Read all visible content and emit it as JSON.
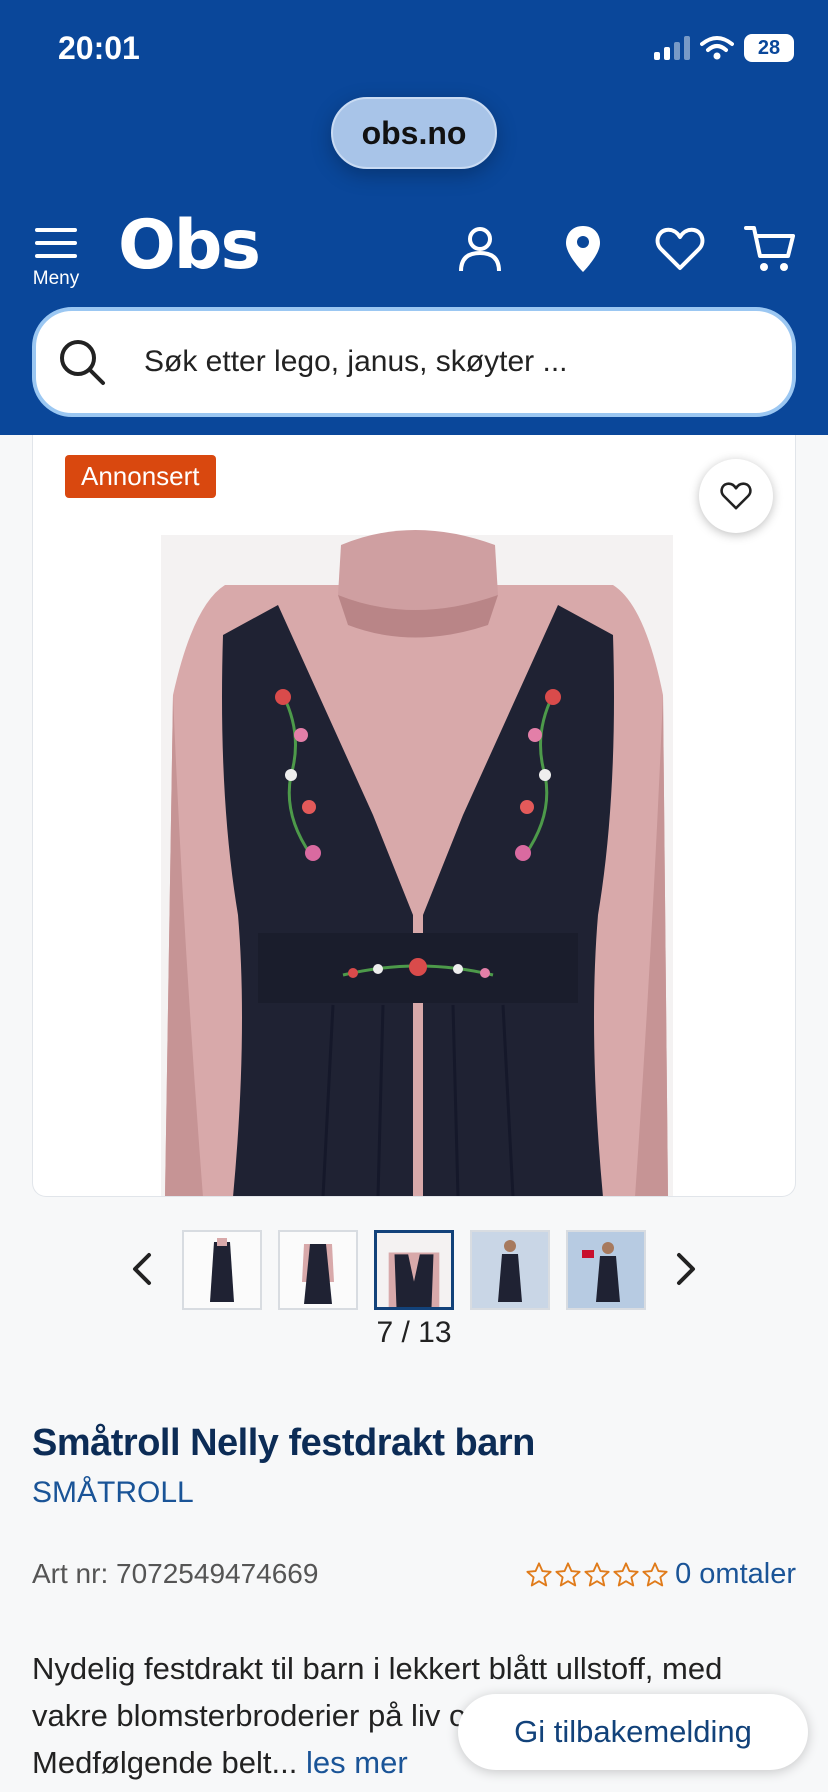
{
  "status_bar": {
    "time": "20:01",
    "battery": "28"
  },
  "browser": {
    "url": "obs.no"
  },
  "header": {
    "menu_label": "Meny",
    "logo_text": "Obs",
    "brand_color": "#0a479a",
    "icons": [
      "user-icon",
      "location-pin-icon",
      "heart-icon",
      "cart-icon"
    ]
  },
  "search": {
    "placeholder": "Søk etter lego, janus, skøyter ..."
  },
  "product_image": {
    "ad_badge": "Annonsert"
  },
  "gallery": {
    "pager": "7 / 13",
    "active_thumb_index": 2
  },
  "product": {
    "title": "Småtroll Nelly festdrakt barn",
    "brand": "SMÅTROLL",
    "art_nr": "Art nr: 7072549474669",
    "rating_stars": 0,
    "reviews": "0 omtaler",
    "description": "Nydelig festdrakt til barn i lekkert blått ullstoff, med vakre blomsterbroderier på liv og belte i fløyel. Medfølgende belt...",
    "read_more": "les mer"
  },
  "feedback": {
    "label": "Gi tilbakemelding"
  }
}
